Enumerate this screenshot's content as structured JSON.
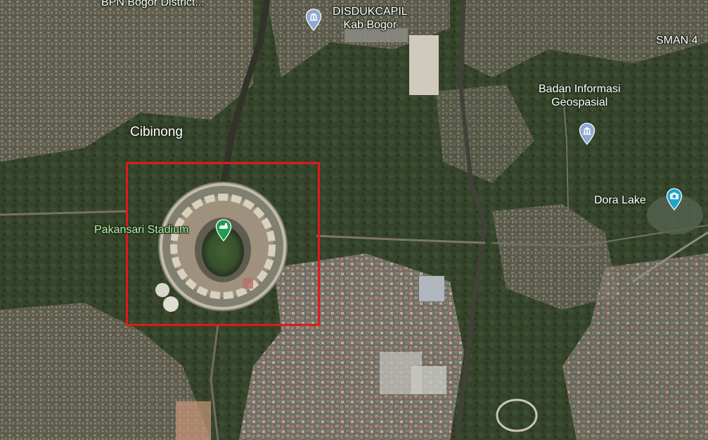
{
  "map": {
    "type": "satellite",
    "place_labels": {
      "bpn": "BPN Bogor District...",
      "disdukcapil_line1": "DISDUKCAPIL",
      "disdukcapil_line2": "Kab Bogor",
      "sman": "SMAN 4",
      "badan_line1": "Badan Informasi",
      "badan_line2": "Geospasial",
      "cibinong": "Cibinong",
      "dora_lake": "Dora Lake",
      "stadium": "Pakansari Stadium"
    },
    "icons": {
      "disdukcapil": "government-building-icon",
      "badan": "government-building-icon",
      "dora_lake": "camera-attraction-icon",
      "stadium": "stadium-icon"
    },
    "colors": {
      "highlight": "#e01a1a",
      "pin_blue": "#8ea9cf",
      "pin_teal": "#1ea6c9",
      "pin_green": "#1e9c50",
      "stadium_label": "#aef1a6"
    }
  }
}
